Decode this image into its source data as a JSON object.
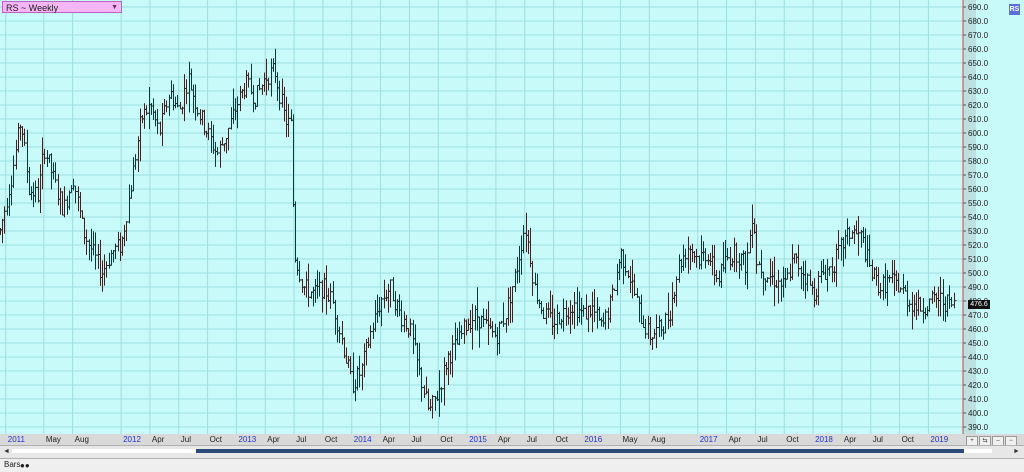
{
  "header": {
    "symbol_label": "RS ~ Weekly",
    "dropdown_glyph": "▼",
    "corner_badge": "RS"
  },
  "price_tag": "476.6",
  "footer": {
    "bars_label": "Bars",
    "bars_icon": "●●"
  },
  "scrollbar": {
    "left_arrow": "◄",
    "right_arrow": "►"
  },
  "nav_buttons": [
    "+",
    "⇆",
    "–",
    "−"
  ],
  "colors": {
    "background": "#c8fafa",
    "grid": "#9edede",
    "bars": "#2a2a2a",
    "year_label": "#2233cc",
    "month_label": "#222222",
    "scroll_thumb": "#2b4a7a"
  },
  "chart_data": {
    "type": "ohlc",
    "title": "RS ~ Weekly",
    "ylim": [
      385,
      695
    ],
    "y_ticks": [
      390,
      400,
      410,
      420,
      430,
      440,
      450,
      460,
      470,
      480,
      490,
      500,
      510,
      520,
      530,
      540,
      550,
      560,
      570,
      580,
      590,
      600,
      610,
      620,
      630,
      640,
      650,
      660,
      670,
      680,
      690
    ],
    "y_tick_labels": [
      "390.0",
      "400.0",
      "410.0",
      "420.0",
      "430.0",
      "440.0",
      "450.0",
      "460.0",
      "470.0",
      "480.0",
      "490.0",
      "500.0",
      "510.0",
      "520.0",
      "530.0",
      "540.0",
      "550.0",
      "560.0",
      "570.0",
      "580.0",
      "590.0",
      "600.0",
      "610.0",
      "620.0",
      "630.0",
      "640.0",
      "650.0",
      "660.0",
      "670.0",
      "680.0",
      "690.0"
    ],
    "x_range": [
      2010.95,
      2019.3
    ],
    "x_ticks": [
      {
        "t": 2011.0,
        "label": "2011",
        "year": true
      },
      {
        "t": 2011.33,
        "label": "May",
        "year": false
      },
      {
        "t": 2011.58,
        "label": "Aug",
        "year": false
      },
      {
        "t": 2012.0,
        "label": "2012",
        "year": true
      },
      {
        "t": 2012.25,
        "label": "Apr",
        "year": false
      },
      {
        "t": 2012.5,
        "label": "Jul",
        "year": false
      },
      {
        "t": 2012.75,
        "label": "Oct",
        "year": false
      },
      {
        "t": 2013.0,
        "label": "2013",
        "year": true
      },
      {
        "t": 2013.25,
        "label": "Apr",
        "year": false
      },
      {
        "t": 2013.5,
        "label": "Jul",
        "year": false
      },
      {
        "t": 2013.75,
        "label": "Oct",
        "year": false
      },
      {
        "t": 2014.0,
        "label": "2014",
        "year": true
      },
      {
        "t": 2014.25,
        "label": "Apr",
        "year": false
      },
      {
        "t": 2014.5,
        "label": "Jul",
        "year": false
      },
      {
        "t": 2014.75,
        "label": "Oct",
        "year": false
      },
      {
        "t": 2015.0,
        "label": "2015",
        "year": true
      },
      {
        "t": 2015.25,
        "label": "Apr",
        "year": false
      },
      {
        "t": 2015.5,
        "label": "Jul",
        "year": false
      },
      {
        "t": 2015.75,
        "label": "Oct",
        "year": false
      },
      {
        "t": 2016.0,
        "label": "2016",
        "year": true
      },
      {
        "t": 2016.33,
        "label": "May",
        "year": false
      },
      {
        "t": 2016.58,
        "label": "Aug",
        "year": false
      },
      {
        "t": 2017.0,
        "label": "2017",
        "year": true
      },
      {
        "t": 2017.25,
        "label": "Apr",
        "year": false
      },
      {
        "t": 2017.5,
        "label": "Jul",
        "year": false
      },
      {
        "t": 2017.75,
        "label": "Oct",
        "year": false
      },
      {
        "t": 2018.0,
        "label": "2018",
        "year": true
      },
      {
        "t": 2018.25,
        "label": "Apr",
        "year": false
      },
      {
        "t": 2018.5,
        "label": "Jul",
        "year": false
      },
      {
        "t": 2018.75,
        "label": "Oct",
        "year": false
      },
      {
        "t": 2019.0,
        "label": "2019",
        "year": true
      }
    ],
    "anchors": [
      [
        2010.95,
        530
      ],
      [
        2011.05,
        570
      ],
      [
        2011.13,
        610
      ],
      [
        2011.2,
        560
      ],
      [
        2011.28,
        555
      ],
      [
        2011.33,
        590
      ],
      [
        2011.42,
        565
      ],
      [
        2011.5,
        545
      ],
      [
        2011.58,
        570
      ],
      [
        2011.67,
        530
      ],
      [
        2011.75,
        515
      ],
      [
        2011.83,
        500
      ],
      [
        2011.92,
        515
      ],
      [
        2012.0,
        520
      ],
      [
        2012.08,
        560
      ],
      [
        2012.17,
        610
      ],
      [
        2012.25,
        620
      ],
      [
        2012.33,
        600
      ],
      [
        2012.42,
        630
      ],
      [
        2012.5,
        615
      ],
      [
        2012.58,
        640
      ],
      [
        2012.67,
        615
      ],
      [
        2012.75,
        600
      ],
      [
        2012.83,
        585
      ],
      [
        2012.92,
        600
      ],
      [
        2013.0,
        620
      ],
      [
        2013.08,
        635
      ],
      [
        2013.17,
        625
      ],
      [
        2013.25,
        640
      ],
      [
        2013.33,
        645
      ],
      [
        2013.42,
        610
      ],
      [
        2013.47,
        605
      ],
      [
        2013.5,
        515
      ],
      [
        2013.58,
        490
      ],
      [
        2013.67,
        485
      ],
      [
        2013.75,
        490
      ],
      [
        2013.83,
        480
      ],
      [
        2013.92,
        450
      ],
      [
        2014.0,
        420
      ],
      [
        2014.08,
        430
      ],
      [
        2014.17,
        460
      ],
      [
        2014.25,
        480
      ],
      [
        2014.33,
        490
      ],
      [
        2014.42,
        470
      ],
      [
        2014.5,
        460
      ],
      [
        2014.58,
        430
      ],
      [
        2014.67,
        400
      ],
      [
        2014.75,
        415
      ],
      [
        2014.83,
        440
      ],
      [
        2014.92,
        450
      ],
      [
        2015.0,
        465
      ],
      [
        2015.08,
        470
      ],
      [
        2015.17,
        460
      ],
      [
        2015.25,
        455
      ],
      [
        2015.33,
        470
      ],
      [
        2015.42,
        500
      ],
      [
        2015.5,
        535
      ],
      [
        2015.55,
        510
      ],
      [
        2015.58,
        490
      ],
      [
        2015.67,
        470
      ],
      [
        2015.75,
        465
      ],
      [
        2015.83,
        472
      ],
      [
        2015.92,
        478
      ],
      [
        2016.0,
        470
      ],
      [
        2016.08,
        475
      ],
      [
        2016.17,
        460
      ],
      [
        2016.25,
        480
      ],
      [
        2016.33,
        515
      ],
      [
        2016.4,
        500
      ],
      [
        2016.5,
        470
      ],
      [
        2016.58,
        455
      ],
      [
        2016.67,
        460
      ],
      [
        2016.75,
        470
      ],
      [
        2016.83,
        505
      ],
      [
        2016.92,
        520
      ],
      [
        2017.0,
        510
      ],
      [
        2017.08,
        515
      ],
      [
        2017.17,
        495
      ],
      [
        2017.25,
        510
      ],
      [
        2017.33,
        515
      ],
      [
        2017.42,
        505
      ],
      [
        2017.48,
        550
      ],
      [
        2017.5,
        510
      ],
      [
        2017.58,
        500
      ],
      [
        2017.67,
        495
      ],
      [
        2017.75,
        490
      ],
      [
        2017.83,
        510
      ],
      [
        2017.92,
        500
      ],
      [
        2018.0,
        485
      ],
      [
        2018.08,
        500
      ],
      [
        2018.17,
        505
      ],
      [
        2018.25,
        520
      ],
      [
        2018.33,
        530
      ],
      [
        2018.42,
        525
      ],
      [
        2018.5,
        500
      ],
      [
        2018.58,
        490
      ],
      [
        2018.67,
        495
      ],
      [
        2018.75,
        490
      ],
      [
        2018.83,
        480
      ],
      [
        2018.92,
        475
      ],
      [
        2019.0,
        478
      ],
      [
        2019.08,
        482
      ],
      [
        2019.17,
        478
      ],
      [
        2019.22,
        476.6
      ]
    ]
  }
}
